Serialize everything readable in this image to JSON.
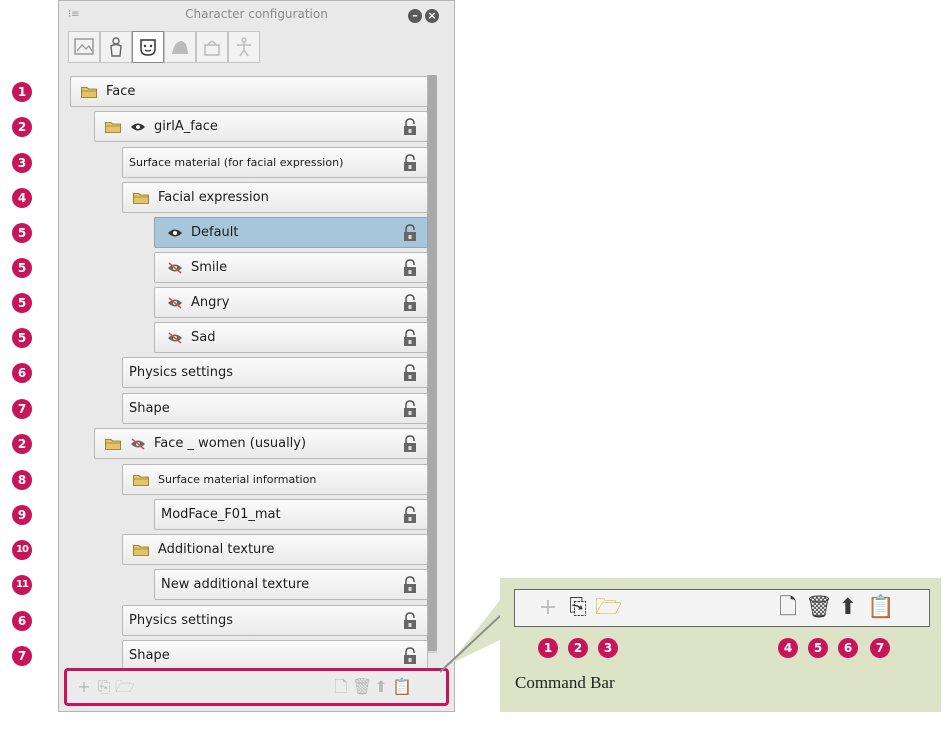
{
  "panel": {
    "title": "Character configuration",
    "menu_glyph": "⁝≡",
    "minimize_glyph": "–",
    "close_glyph": "×"
  },
  "tabs": [
    {
      "icon": "image-icon"
    },
    {
      "icon": "body-icon"
    },
    {
      "icon": "face-icon",
      "active": true
    },
    {
      "icon": "hair-icon"
    },
    {
      "icon": "accessory-icon"
    },
    {
      "icon": "pose-icon"
    }
  ],
  "tree": [
    {
      "marker": "1",
      "label": "Face",
      "folder": true,
      "eye": "none",
      "lock": false,
      "selected": false,
      "small": false
    },
    {
      "marker": "2",
      "label": "girlA_face",
      "folder": true,
      "eye": "visible",
      "lock": true,
      "selected": false,
      "small": false
    },
    {
      "marker": "3",
      "label": "Surface material (for facial expression)",
      "folder": false,
      "eye": "none",
      "lock": true,
      "selected": false,
      "small": true
    },
    {
      "marker": "4",
      "label": "Facial expression",
      "folder": true,
      "eye": "none",
      "lock": false,
      "selected": false,
      "small": false
    },
    {
      "marker": "5",
      "label": "Default",
      "folder": false,
      "eye": "visible",
      "lock": true,
      "selected": true,
      "small": false
    },
    {
      "marker": "5",
      "label": "Smile",
      "folder": false,
      "eye": "hidden",
      "lock": true,
      "selected": false,
      "small": false
    },
    {
      "marker": "5",
      "label": "Angry",
      "folder": false,
      "eye": "hidden",
      "lock": true,
      "selected": false,
      "small": false
    },
    {
      "marker": "5",
      "label": "Sad",
      "folder": false,
      "eye": "hidden",
      "lock": true,
      "selected": false,
      "small": false
    },
    {
      "marker": "6",
      "label": "Physics settings",
      "folder": false,
      "eye": "none",
      "lock": true,
      "selected": false,
      "small": false
    },
    {
      "marker": "7",
      "label": "Shape",
      "folder": false,
      "eye": "none",
      "lock": true,
      "selected": false,
      "small": false
    },
    {
      "marker": "2",
      "label": "Face _ women (usually)",
      "folder": true,
      "eye": "hidden",
      "lock": true,
      "selected": false,
      "small": false
    },
    {
      "marker": "8",
      "label": "Surface material information",
      "folder": true,
      "eye": "none",
      "lock": false,
      "selected": false,
      "small": true
    },
    {
      "marker": "9",
      "label": "ModFace_F01_mat",
      "folder": false,
      "eye": "none",
      "lock": true,
      "selected": false,
      "small": false
    },
    {
      "marker": "10",
      "label": "Additional texture",
      "folder": true,
      "eye": "none",
      "lock": false,
      "selected": false,
      "small": false
    },
    {
      "marker": "11",
      "label": "New additional texture",
      "folder": false,
      "eye": "none",
      "lock": true,
      "selected": false,
      "small": false
    },
    {
      "marker": "6",
      "label": "Physics settings",
      "folder": false,
      "eye": "none",
      "lock": true,
      "selected": false,
      "small": false
    },
    {
      "marker": "7",
      "label": "Shape",
      "folder": false,
      "eye": "none",
      "lock": true,
      "selected": false,
      "small": false
    }
  ],
  "command_bar": {
    "label": "Command Bar",
    "buttons": [
      {
        "icon": "add-icon",
        "glyph": "+",
        "marker": "1",
        "enabled": false
      },
      {
        "icon": "new-folder-icon",
        "glyph": "⎘",
        "marker": "2",
        "enabled": true
      },
      {
        "icon": "open-folder-icon",
        "glyph": "🗁",
        "marker": "3",
        "enabled": true
      },
      {
        "icon": "new-page-icon",
        "glyph": "🗋",
        "marker": "4",
        "enabled": true
      },
      {
        "icon": "trash-icon",
        "glyph": "🗑",
        "marker": "5",
        "enabled": true
      },
      {
        "icon": "export-icon",
        "glyph": "⬆",
        "marker": "6",
        "enabled": true
      },
      {
        "icon": "clipboard-icon",
        "glyph": "📋",
        "marker": "7",
        "enabled": true
      }
    ]
  },
  "colors": {
    "marker": "#c8155a",
    "selected_row": "#a7c6d9",
    "callout_bg": "#dde3c6",
    "folder": "#e2c56b"
  }
}
